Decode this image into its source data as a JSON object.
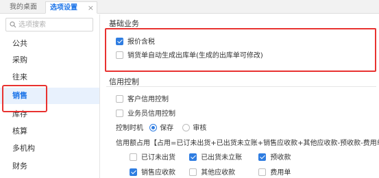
{
  "tabs": {
    "home_label": "我的桌面",
    "active_label": "选项设置",
    "close_glyph": "×"
  },
  "sidebar": {
    "search_placeholder": "选项搜索",
    "items": [
      {
        "label": "公共"
      },
      {
        "label": "采购"
      },
      {
        "label": "往来"
      },
      {
        "label": "销售"
      },
      {
        "label": "库存"
      },
      {
        "label": "核算"
      },
      {
        "label": "多机构"
      },
      {
        "label": "财务"
      }
    ],
    "selected": "销售"
  },
  "basic": {
    "title": "基础业务",
    "price_tax": {
      "label": "报价含税",
      "checked": true
    },
    "auto_outbound": {
      "label": "销货单自动生成出库单(生成的出库单可修改)",
      "checked": false
    }
  },
  "credit": {
    "title": "信用控制",
    "customer_credit": {
      "label": "客户信用控制",
      "checked": false
    },
    "salesman_credit": {
      "label": "业务员信用控制",
      "checked": false
    },
    "timing": {
      "label": "控制时机",
      "options": [
        {
          "label": "保存",
          "selected": true
        },
        {
          "label": "审核",
          "selected": false
        }
      ]
    },
    "formula": "信用额占用【占用=已订未出货+已出货未立账+销售应收款+其他应收款-预收款-费用单（冲减",
    "occupy_row1": [
      {
        "label": "已订未出货",
        "checked": false
      },
      {
        "label": "已出货未立账",
        "checked": true
      },
      {
        "label": "预收款",
        "checked": true
      }
    ],
    "occupy_row2": [
      {
        "label": "销售应收款",
        "checked": true
      },
      {
        "label": "其他应收款",
        "checked": false
      },
      {
        "label": "费用单",
        "checked": false
      }
    ]
  },
  "colors": {
    "accent": "#1a73e8",
    "checkbox": "#2f7de1",
    "highlight": "#e8312f"
  }
}
